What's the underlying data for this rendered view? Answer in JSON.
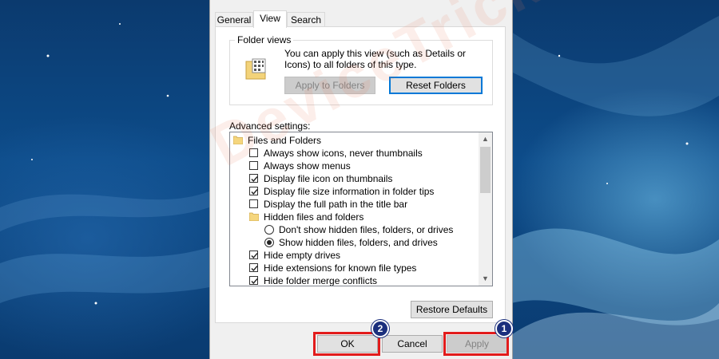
{
  "tabs": [
    {
      "label": "General",
      "active": false
    },
    {
      "label": "View",
      "active": true
    },
    {
      "label": "Search",
      "active": false
    }
  ],
  "folder_views": {
    "title": "Folder views",
    "description": "You can apply this view (such as Details or Icons) to all folders of this type.",
    "apply_button": "Apply to Folders",
    "reset_button": "Reset Folders"
  },
  "advanced": {
    "label": "Advanced settings:",
    "items": [
      {
        "type": "folder",
        "label": "Files and Folders",
        "level": 0
      },
      {
        "type": "checkbox",
        "label": "Always show icons, never thumbnails",
        "checked": false,
        "level": 1
      },
      {
        "type": "checkbox",
        "label": "Always show menus",
        "checked": false,
        "level": 1
      },
      {
        "type": "checkbox",
        "label": "Display file icon on thumbnails",
        "checked": true,
        "level": 1
      },
      {
        "type": "checkbox",
        "label": "Display file size information in folder tips",
        "checked": true,
        "level": 1
      },
      {
        "type": "checkbox",
        "label": "Display the full path in the title bar",
        "checked": false,
        "level": 1
      },
      {
        "type": "folder",
        "label": "Hidden files and folders",
        "level": 1
      },
      {
        "type": "radio",
        "label": "Don't show hidden files, folders, or drives",
        "selected": false,
        "level": 2
      },
      {
        "type": "radio",
        "label": "Show hidden files, folders, and drives",
        "selected": true,
        "level": 2
      },
      {
        "type": "checkbox",
        "label": "Hide empty drives",
        "checked": true,
        "level": 1
      },
      {
        "type": "checkbox",
        "label": "Hide extensions for known file types",
        "checked": true,
        "level": 1
      },
      {
        "type": "checkbox",
        "label": "Hide folder merge conflicts",
        "checked": true,
        "level": 1
      }
    ],
    "restore_button": "Restore Defaults"
  },
  "footer": {
    "ok": "OK",
    "cancel": "Cancel",
    "apply": "Apply"
  },
  "annotations": [
    {
      "step": "2",
      "target": "ok"
    },
    {
      "step": "1",
      "target": "apply"
    }
  ],
  "watermark": "DeviceTricks",
  "colors": {
    "highlight": "#e21b1b",
    "badge": "#1b2f7d",
    "focus_border": "#0078d7"
  }
}
